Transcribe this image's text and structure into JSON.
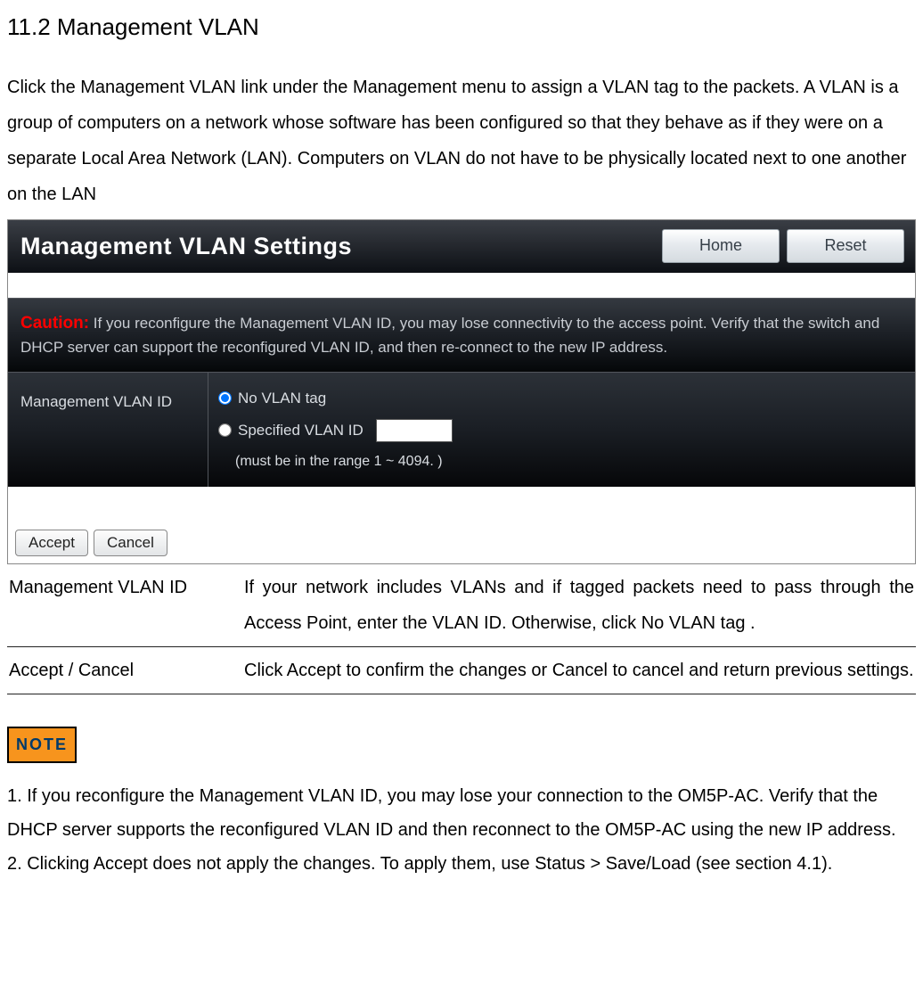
{
  "section_title": "11.2 Management VLAN",
  "intro": "Click the Management VLAN link under the Management menu to assign a VLAN tag to the packets. A VLAN is a group of computers on a network whose software has been configured so that they behave as if they were on a separate Local Area Network (LAN). Computers on VLAN do not have to be physically located next to one another on the LAN",
  "panel": {
    "title": "Management VLAN Settings",
    "home_btn": "Home",
    "reset_btn": "Reset",
    "caution_label": "Caution:",
    "caution_text": " If you reconfigure the Management VLAN ID, you may lose connectivity to the access point. Verify that the switch and DHCP server can support the reconfigured VLAN ID, and then re-connect to the new IP address.",
    "vlan_row_label": "Management VLAN ID",
    "no_vlan_label": "No VLAN tag",
    "spec_vlan_label": "Specified VLAN ID",
    "vlan_input_value": "",
    "range_hint": "(must be in the range 1 ~ 4094. )",
    "accept_btn": "Accept",
    "cancel_btn": "Cancel"
  },
  "desc": {
    "row1_label": "Management VLAN ID",
    "row1_text": "If your network includes VLANs and if tagged packets need to pass through  the Access Point, enter the VLAN ID. Otherwise, click No VLAN tag .",
    "row2_label": "Accept / Cancel",
    "row2_text": "Click Accept to confirm the changes or Cancel to cancel and return previous settings."
  },
  "note_badge": "NOTE",
  "note1": "1. If you reconfigure the Management VLAN ID, you may lose your connection to the OM5P-AC. Verify that the DHCP server supports the reconfigured VLAN ID and then reconnect to the OM5P-AC using the new IP address.",
  "note2": "2. Clicking Accept does not apply the changes. To apply them, use Status > Save/Load (see section 4.1)."
}
